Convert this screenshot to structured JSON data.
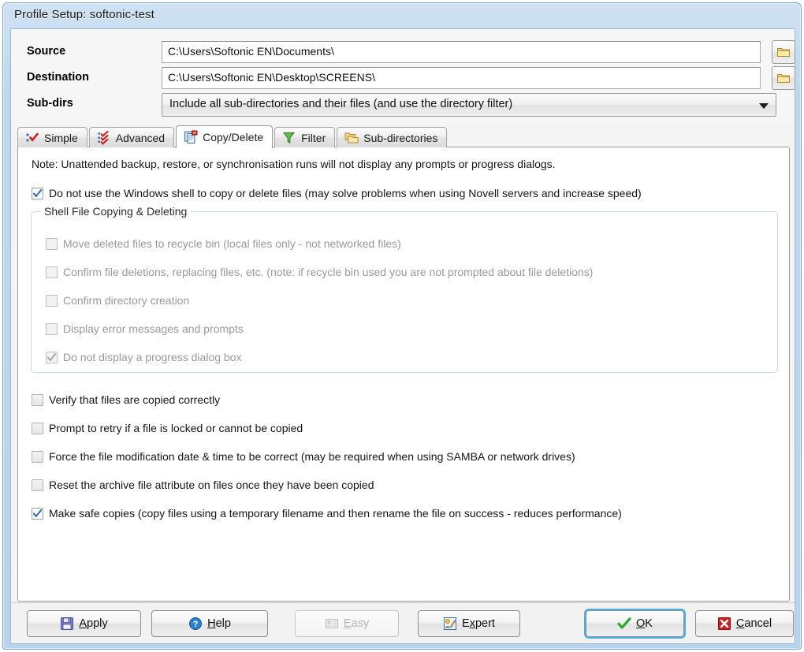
{
  "window": {
    "title": "Profile Setup: softonic-test"
  },
  "fields": {
    "source": {
      "label": "Source",
      "value": "C:\\Users\\Softonic EN\\Documents\\",
      "browse_icon": "folder-icon"
    },
    "destination": {
      "label": "Destination",
      "value": "C:\\Users\\Softonic EN\\Desktop\\SCREENS\\",
      "browse_icon": "folder-icon"
    },
    "subdirs": {
      "label": "Sub-dirs",
      "value": "Include all sub-directories and their files (and use the directory filter)",
      "arrow_icon": "chevron-down-icon"
    }
  },
  "tabs": [
    {
      "label": "Simple",
      "icon": "simple-check-icon",
      "active": false
    },
    {
      "label": "Advanced",
      "icon": "advanced-checks-icon",
      "active": false
    },
    {
      "label": "Copy/Delete",
      "icon": "copy-delete-icon",
      "active": true
    },
    {
      "label": "Filter",
      "icon": "funnel-icon",
      "active": false
    },
    {
      "label": "Sub-directories",
      "icon": "folders-icon",
      "active": false
    }
  ],
  "page": {
    "note": "Note: Unattended backup, restore, or synchronisation runs will not display any prompts or progress dialogs.",
    "main_option": {
      "label": "Do not use the Windows shell to copy or delete files (may solve problems when using Novell servers and increase speed)",
      "checked": true,
      "enabled": true
    },
    "group": {
      "title": "Shell File Copying & Deleting",
      "options": [
        {
          "label": "Move deleted files to recycle bin (local files only - not networked files)",
          "checked": false,
          "enabled": false
        },
        {
          "label": "Confirm file deletions, replacing files, etc. (note: if recycle bin used you are not prompted about file deletions)",
          "checked": false,
          "enabled": false
        },
        {
          "label": "Confirm directory creation",
          "checked": false,
          "enabled": false
        },
        {
          "label": "Display error messages and prompts",
          "checked": false,
          "enabled": false
        },
        {
          "label": "Do not display a progress dialog box",
          "checked": true,
          "enabled": false
        }
      ]
    },
    "options": [
      {
        "label": "Verify that files are copied correctly",
        "checked": false,
        "enabled": true
      },
      {
        "label": "Prompt to retry if a file is locked or cannot be copied",
        "checked": false,
        "enabled": true
      },
      {
        "label": "Force the file modification date & time to be correct (may be required when using SAMBA or network drives)",
        "checked": false,
        "enabled": true
      },
      {
        "label": "Reset the archive file attribute on files once they have been copied",
        "checked": false,
        "enabled": true
      },
      {
        "label": "Make safe copies (copy files using a temporary filename and then rename the file on success - reduces performance)",
        "checked": true,
        "enabled": true
      }
    ]
  },
  "buttons": {
    "apply": {
      "pre": "",
      "accel": "A",
      "post": "pply",
      "icon": "floppy-disk-icon",
      "enabled": true,
      "default": false
    },
    "help": {
      "pre": "",
      "accel": "H",
      "post": "elp",
      "icon": "question-mark-icon",
      "enabled": true,
      "default": false
    },
    "easy": {
      "pre": "",
      "accel": "E",
      "post": "asy",
      "icon": "easy-card-icon",
      "enabled": false,
      "default": false
    },
    "expert": {
      "pre": "E",
      "accel": "x",
      "post": "pert",
      "icon": "expert-wand-icon",
      "enabled": true,
      "default": false
    },
    "ok": {
      "pre": "",
      "accel": "O",
      "post": "K",
      "icon": "green-check-icon",
      "enabled": true,
      "default": true
    },
    "cancel": {
      "pre": "",
      "accel": "C",
      "post": "ancel",
      "icon": "red-x-icon",
      "enabled": true,
      "default": false
    }
  },
  "colors": {
    "titlebar": "#bed8ee",
    "accent_focus": "#48b0e8",
    "check_blue": "#2d6fb5",
    "check_green": "#2aa92a",
    "cancel_red": "#cc1f1f",
    "folder_yellow": "#f2cb55"
  }
}
